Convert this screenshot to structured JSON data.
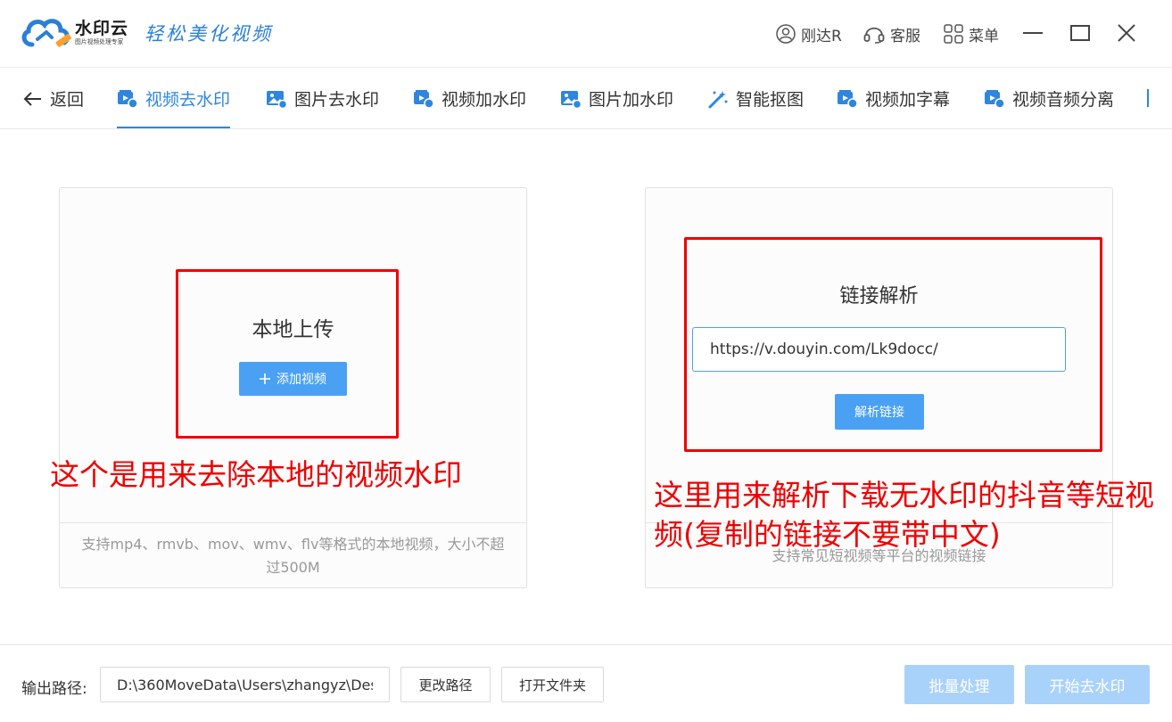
{
  "app": {
    "brand_name": "水印云",
    "brand_sub": "图片视频处理专家",
    "slogan": "轻松美化视频"
  },
  "titlebar": {
    "user_name": "刚达R",
    "service_label": "客服",
    "menu_label": "菜单"
  },
  "toolbar": {
    "back_label": "返回",
    "tools": [
      {
        "label": "视频去水印",
        "icon": "video-icon",
        "active": true
      },
      {
        "label": "图片去水印",
        "icon": "image-icon",
        "active": false
      },
      {
        "label": "视频加水印",
        "icon": "video-icon",
        "active": false
      },
      {
        "label": "图片加水印",
        "icon": "image-icon",
        "active": false
      },
      {
        "label": "智能抠图",
        "icon": "magic-wand-icon",
        "active": false
      },
      {
        "label": "视频加字幕",
        "icon": "video-icon",
        "active": false
      },
      {
        "label": "视频音频分离",
        "icon": "video-icon",
        "active": false
      }
    ]
  },
  "local_panel": {
    "title": "本地上传",
    "add_button": "添加视频",
    "footer": "支持mp4、rmvb、mov、wmv、flv等格式的本地视频，大小不超过500M"
  },
  "link_panel": {
    "title": "链接解析",
    "input_value": "https://v.douyin.com/Lk9docc/",
    "parse_button": "解析链接",
    "footer": "支持常见短视频等平台的视频链接"
  },
  "annotations": {
    "left": "这个是用来去除本地的视频水印",
    "right_line1": "这里用来解析下载无水印的抖音等短视",
    "right_line2": "频(复制的链接不要带中文)"
  },
  "bottom": {
    "output_label": "输出路径:",
    "output_path": "D:\\360MoveData\\Users\\zhangyz\\Des",
    "change_path": "更改路径",
    "open_folder": "打开文件夹",
    "batch": "批量处理",
    "start": "开始去水印"
  },
  "colors": {
    "accent": "#2e86de",
    "button_blue": "#4aa1f3",
    "button_disabled": "#a9d2fb",
    "annotation_red": "#f00000"
  }
}
